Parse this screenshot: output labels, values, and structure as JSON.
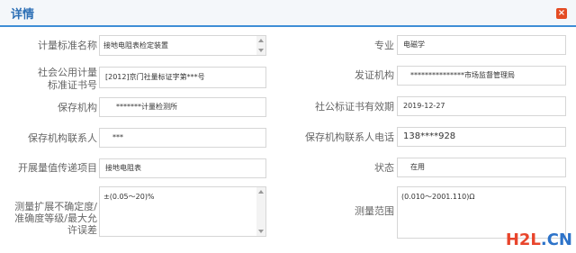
{
  "dialog": {
    "title": "详情",
    "close_icon": "close-icon"
  },
  "left": [
    {
      "label": "计量标准名称",
      "value": "接地电阻表检定装置"
    },
    {
      "label": "社会公用计量标准证书号",
      "value": "[2012]京门社量标证字第***号"
    },
    {
      "label": "保存机构",
      "value": "*******计量检测所"
    },
    {
      "label": "保存机构联系人",
      "value": "***"
    },
    {
      "label": "开展量值传递项目",
      "value": "接地电阻表"
    },
    {
      "label": "测量扩展不确定度/准确度等级/最大允许误差",
      "value": "±(0.05～20)%"
    }
  ],
  "right": [
    {
      "label": "专业",
      "value": "电磁学"
    },
    {
      "label": "发证机构",
      "value": "***************市场监督管理局"
    },
    {
      "label": "社公标证书有效期",
      "value": "2019-12-27"
    },
    {
      "label": "保存机构联系人电话",
      "value": "138****928"
    },
    {
      "label": "状态",
      "value": "在用"
    },
    {
      "label": "测量范围",
      "value": "(0.010～2001.110)Ω"
    }
  ],
  "watermark": {
    "part1": "H2L",
    "part2": ".CN"
  }
}
